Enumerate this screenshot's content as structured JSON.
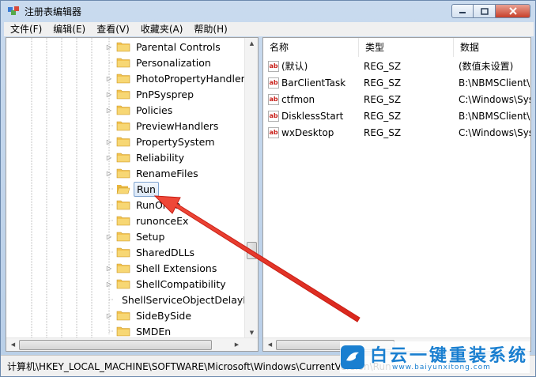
{
  "window": {
    "title": "注册表编辑器",
    "controls": {
      "minimize": "minimize-icon",
      "maximize": "maximize-icon",
      "close": "close-icon"
    }
  },
  "menu": [
    "文件(F)",
    "编辑(E)",
    "查看(V)",
    "收藏夹(A)",
    "帮助(H)"
  ],
  "tree": {
    "items": [
      {
        "label": "Parental Controls",
        "expandable": true,
        "selected": false
      },
      {
        "label": "Personalization",
        "expandable": false,
        "selected": false
      },
      {
        "label": "PhotoPropertyHandler",
        "expandable": true,
        "selected": false
      },
      {
        "label": "PnPSysprep",
        "expandable": true,
        "selected": false
      },
      {
        "label": "Policies",
        "expandable": true,
        "selected": false
      },
      {
        "label": "PreviewHandlers",
        "expandable": false,
        "selected": false
      },
      {
        "label": "PropertySystem",
        "expandable": true,
        "selected": false
      },
      {
        "label": "Reliability",
        "expandable": true,
        "selected": false
      },
      {
        "label": "RenameFiles",
        "expandable": true,
        "selected": false
      },
      {
        "label": "Run",
        "expandable": false,
        "selected": true
      },
      {
        "label": "RunOnce",
        "expandable": false,
        "selected": false
      },
      {
        "label": "runonceEx",
        "expandable": false,
        "selected": false
      },
      {
        "label": "Setup",
        "expandable": true,
        "selected": false
      },
      {
        "label": "SharedDLLs",
        "expandable": false,
        "selected": false
      },
      {
        "label": "Shell Extensions",
        "expandable": true,
        "selected": false
      },
      {
        "label": "ShellCompatibility",
        "expandable": true,
        "selected": false
      },
      {
        "label": "ShellServiceObjectDelayL",
        "expandable": false,
        "selected": false
      },
      {
        "label": "SideBySide",
        "expandable": true,
        "selected": false
      },
      {
        "label": "SMDEn",
        "expandable": false,
        "selected": false
      }
    ]
  },
  "list": {
    "columns": [
      "名称",
      "类型",
      "数据"
    ],
    "rows": [
      {
        "name": "(默认)",
        "type": "REG_SZ",
        "data": "(数值未设置)"
      },
      {
        "name": "BarClientTask",
        "type": "REG_SZ",
        "data": "B:\\NBMSClient\\"
      },
      {
        "name": "ctfmon",
        "type": "REG_SZ",
        "data": "C:\\Windows\\Sys"
      },
      {
        "name": "DisklessStart",
        "type": "REG_SZ",
        "data": "B:\\NBMSClient\\"
      },
      {
        "name": "wxDesktop",
        "type": "REG_SZ",
        "data": "C:\\Windows\\Sys"
      }
    ],
    "value_icon": "ab"
  },
  "status": {
    "path": "计算机\\HKEY_LOCAL_MACHINE\\SOFTWARE\\Microsoft\\Windows\\CurrentVersion\\Run"
  },
  "watermark": {
    "title": "白云一键重装系统",
    "url": "www.baiyunxitong.com"
  },
  "colors": {
    "arrow": "#e8372c",
    "folder": "#f2c24f",
    "selection": "#dbe8f8",
    "watermark": "#1a7fd0"
  }
}
